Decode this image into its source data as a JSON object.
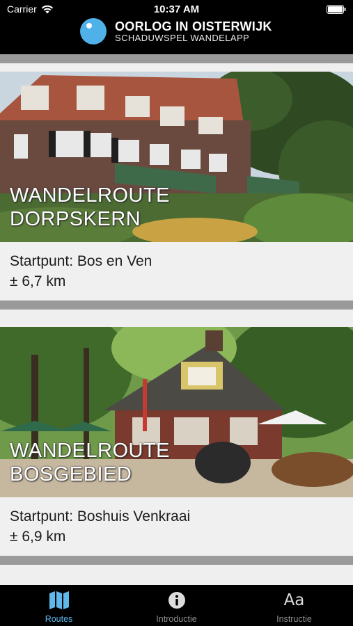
{
  "status_bar": {
    "carrier": "Carrier",
    "time": "10:37 AM"
  },
  "header": {
    "title": "OORLOG IN OISTERWIJK",
    "subtitle": "SCHADUWSPEL WANDELAPP",
    "logo_color": "#4fb1e8"
  },
  "routes": [
    {
      "title_line1": "WANDELROUTE",
      "title_line2": "DORPSKERN",
      "start": "Startpunt: Bos en Ven",
      "distance": "± 6,7 km",
      "image": "hotel-building-photo"
    },
    {
      "title_line1": "WANDELROUTE",
      "title_line2": "BOSGEBIED",
      "start": "Startpunt: Boshuis Venkraai",
      "distance": "± 6,9 km",
      "image": "forest-pavilion-photo"
    }
  ],
  "tab_bar": {
    "tabs": [
      {
        "label": "Routes",
        "icon": "map-icon",
        "active": true
      },
      {
        "label": "Introductie",
        "icon": "info-icon",
        "active": false
      },
      {
        "label": "Instructie",
        "icon": "text-size-icon",
        "active": false
      }
    ],
    "active_color": "#5fb8ec",
    "inactive_color": "#8e8e8e"
  }
}
